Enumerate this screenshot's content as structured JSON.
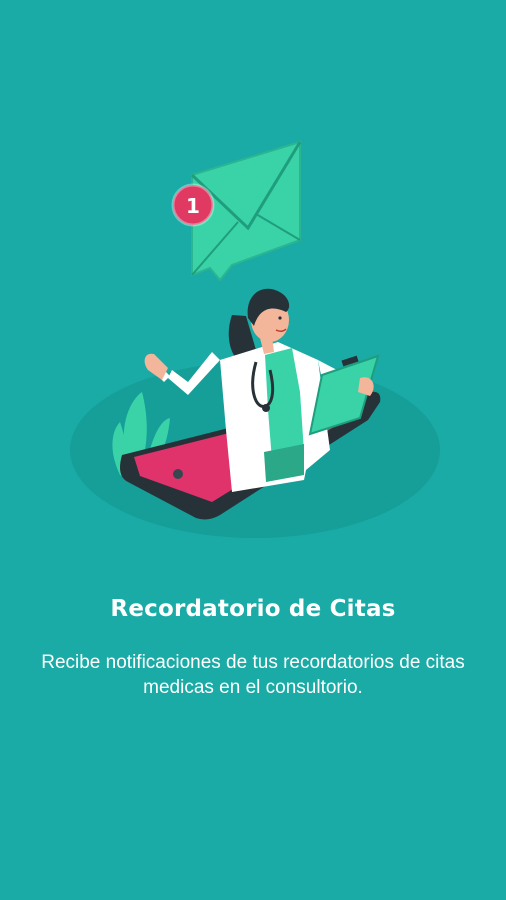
{
  "onboarding": {
    "title": "Recordatorio de Citas",
    "description": "Recibe notificaciones de tus recordatorios de citas medicas en el consultorio.",
    "notification_badge_count": "1",
    "illustration_icon": "doctor-phone-notification-illustration"
  },
  "colors": {
    "background": "#1aaba6",
    "shadow_ellipse": "#169e99",
    "envelope": "#3ad3a8",
    "badge": "#e03a62",
    "phone_body": "#263238",
    "phone_screen": "#e0336b",
    "coat": "#ffffff",
    "scrubs": "#3ad3a8",
    "skin": "#f4b69a",
    "hair": "#263238"
  }
}
